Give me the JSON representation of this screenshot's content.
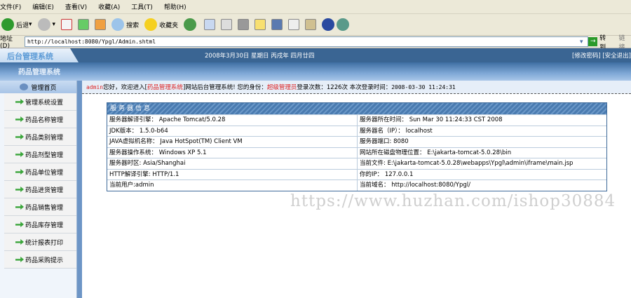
{
  "menu": [
    "文件(F)",
    "编辑(E)",
    "查看(V)",
    "收藏(A)",
    "工具(T)",
    "帮助(H)"
  ],
  "toolbar": {
    "back": "后退",
    "search": "搜索",
    "favorites": "收藏夹"
  },
  "address": {
    "label": "地址(D)",
    "url": "http://localhost:8080/Ypgl/Admin.shtml",
    "go": "转到",
    "links": "链接"
  },
  "header": {
    "logo": "后台管理系统",
    "date": "2008年3月30日 星期日 丙戌年 四月廿四",
    "change_pwd": "[修改密码]",
    "logout": "[安全退出]"
  },
  "band_title": "药品管理系统",
  "sidebar": {
    "home": "管理首页",
    "items": [
      "管理系统设置",
      "药品名称管理",
      "药品类别管理",
      "药品剂型管理",
      "药品单位管理",
      "药品进货管理",
      "药品销售管理",
      "药品库存管理",
      "统计报表打印",
      "药品采购提示"
    ]
  },
  "welcome": {
    "user": "admin",
    "t1": " 您好，欢迎进入[",
    "system": "药品管理系统",
    "t2": "]网站后台管理系统! 您的身份：",
    "role": "超级管理员",
    "t3": " 登录次数：1226次 本次登录时间：",
    "time": "2008-03-30 11:24:31"
  },
  "server": {
    "title": "服务器信息",
    "rows": [
      [
        "服务器解译引擎： Apache Tomcat/5.0.28",
        "服务器所在时间： Sun Mar 30 11:24:33 CST 2008"
      ],
      [
        "JDK版本： 1.5.0-b64",
        "服务器名（IP）： localhost"
      ],
      [
        "JAVA虚拟机名称： Java HotSpot(TM) Client VM",
        "服务器端口: 8080"
      ],
      [
        "服务器操作系统： Windows XP 5.1",
        "网站所在磁盘物理位置： E:\\jakarta-tomcat-5.0.28\\bin"
      ],
      [
        "服务器时区: Asia/Shanghai",
        "当前文件: E:\\jakarta-tomcat-5.0.28\\webapps\\Ypgl\\admin\\iframe\\main.jsp"
      ],
      [
        "HTTP解译引擎: HTTP/1.1",
        "你的IP： 127.0.0.1"
      ],
      [
        "当前用户:admin",
        "当前域名： http://localhost:8080/Ypgl/"
      ]
    ]
  },
  "watermark": "https://www.huzhan.com/ishop30884"
}
